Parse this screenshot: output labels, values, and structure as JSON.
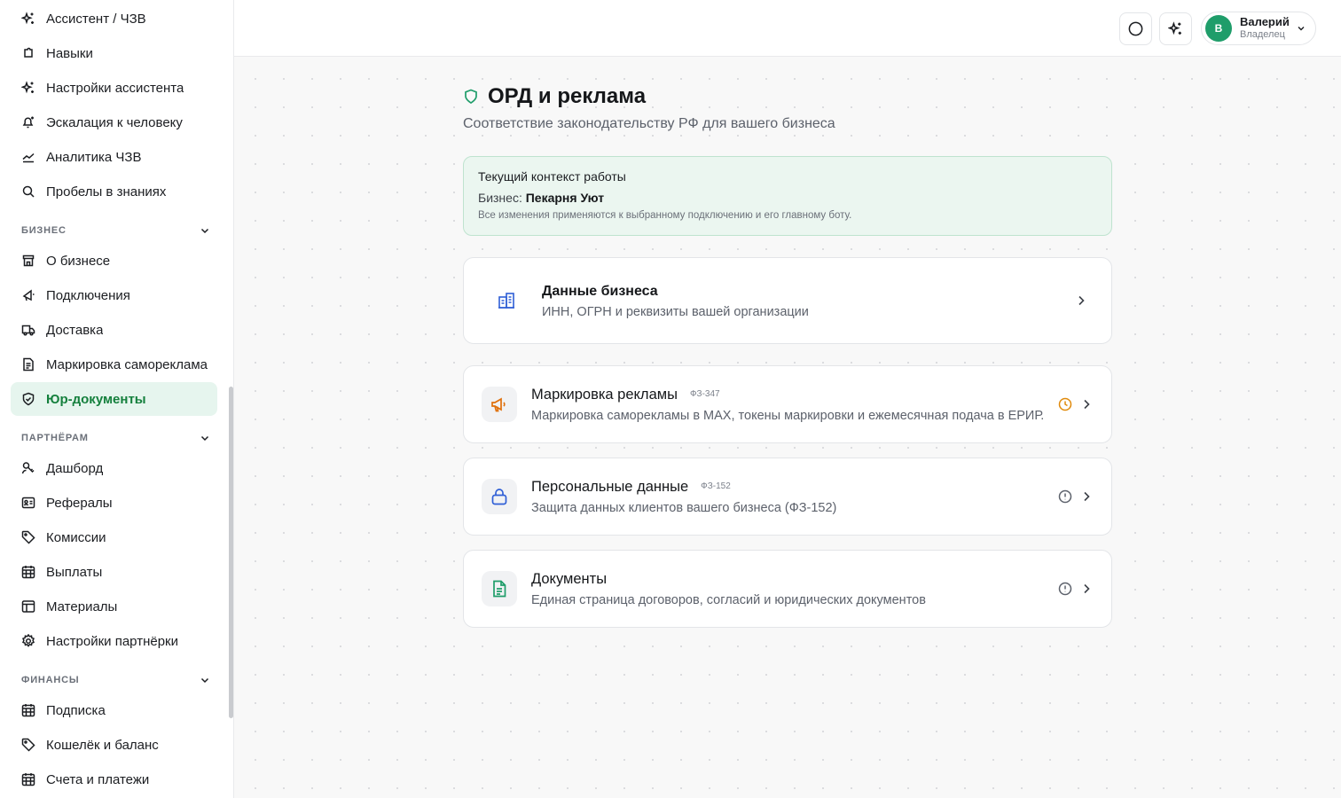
{
  "sidebar": {
    "items_top": [
      {
        "label": "Ассистент / ЧЗВ",
        "icon": "sparkles-icon"
      },
      {
        "label": "Навыки",
        "icon": "puzzle-icon"
      },
      {
        "label": "Настройки ассистента",
        "icon": "sparkles-icon"
      },
      {
        "label": "Эскалация к человеку",
        "icon": "bell-plus-icon"
      },
      {
        "label": "Аналитика ЧЗВ",
        "icon": "trend-line-icon"
      },
      {
        "label": "Пробелы в знаниях",
        "icon": "search-icon"
      }
    ],
    "sections": [
      {
        "title": "БИЗНЕС",
        "items": [
          {
            "label": "О бизнесе",
            "icon": "store-icon"
          },
          {
            "label": "Подключения",
            "icon": "plug-icon"
          },
          {
            "label": "Доставка",
            "icon": "truck-icon"
          },
          {
            "label": "Маркировка самореклама",
            "icon": "document-icon"
          },
          {
            "label": "Юр-документы",
            "icon": "shield-check-icon",
            "active": true
          }
        ]
      },
      {
        "title": "ПАРТНЁРАМ",
        "items": [
          {
            "label": "Дашборд",
            "icon": "key-user-icon"
          },
          {
            "label": "Рефералы",
            "icon": "id-card-icon"
          },
          {
            "label": "Комиссии",
            "icon": "tag-icon"
          },
          {
            "label": "Выплаты",
            "icon": "calendar-grid-icon"
          },
          {
            "label": "Материалы",
            "icon": "layout-icon"
          },
          {
            "label": "Настройки партнёрки",
            "icon": "gear-icon"
          }
        ]
      },
      {
        "title": "ФИНАНСЫ",
        "items": [
          {
            "label": "Подписка",
            "icon": "calendar-grid-icon"
          },
          {
            "label": "Кошелёк и баланс",
            "icon": "tag-icon"
          },
          {
            "label": "Счета и платежи",
            "icon": "calendar-grid-icon"
          }
        ]
      }
    ]
  },
  "header": {
    "user": {
      "initial": "В",
      "name": "Валерий",
      "role": "Владелец"
    }
  },
  "page": {
    "title": "ОРД и реклама",
    "subtitle": "Соответствие законодательству РФ для вашего бизнеса",
    "context": {
      "title": "Текущий контекст работы",
      "business_label": "Бизнес:",
      "business_name": "Пекарня Уют",
      "note": "Все изменения применяются к выбранному подключению и его главному боту."
    },
    "cards": [
      {
        "title": "Данные бизнеса",
        "law": "",
        "desc": "ИНН, ОГРН и реквизиты вашей организации",
        "status": "",
        "icon": "building-icon"
      },
      {
        "title": "Маркировка рекламы",
        "law": "ФЗ-347",
        "desc": "Маркировка саморекламы в MAX, токены маркировки и ежемесячная подача в ЕРИР.",
        "status": "pending",
        "icon": "megaphone-icon"
      },
      {
        "title": "Персональные данные",
        "law": "ФЗ-152",
        "desc": "Защита данных клиентов вашего бизнеса (ФЗ-152)",
        "status": "warning",
        "icon": "lock-icon"
      },
      {
        "title": "Документы",
        "law": "",
        "desc": "Единая страница договоров, согласий и юридических документов",
        "status": "warning",
        "icon": "file-text-icon"
      }
    ]
  },
  "colors": {
    "accent": "#15803d",
    "active_bg": "#e6f5ee",
    "pending": "#e08a0b",
    "warning": "#5c616b",
    "avatar": "#1f9d6a",
    "icon_blue": "#2f5fd6",
    "icon_orange": "#e0700b",
    "icon_green": "#1f9d6a"
  }
}
